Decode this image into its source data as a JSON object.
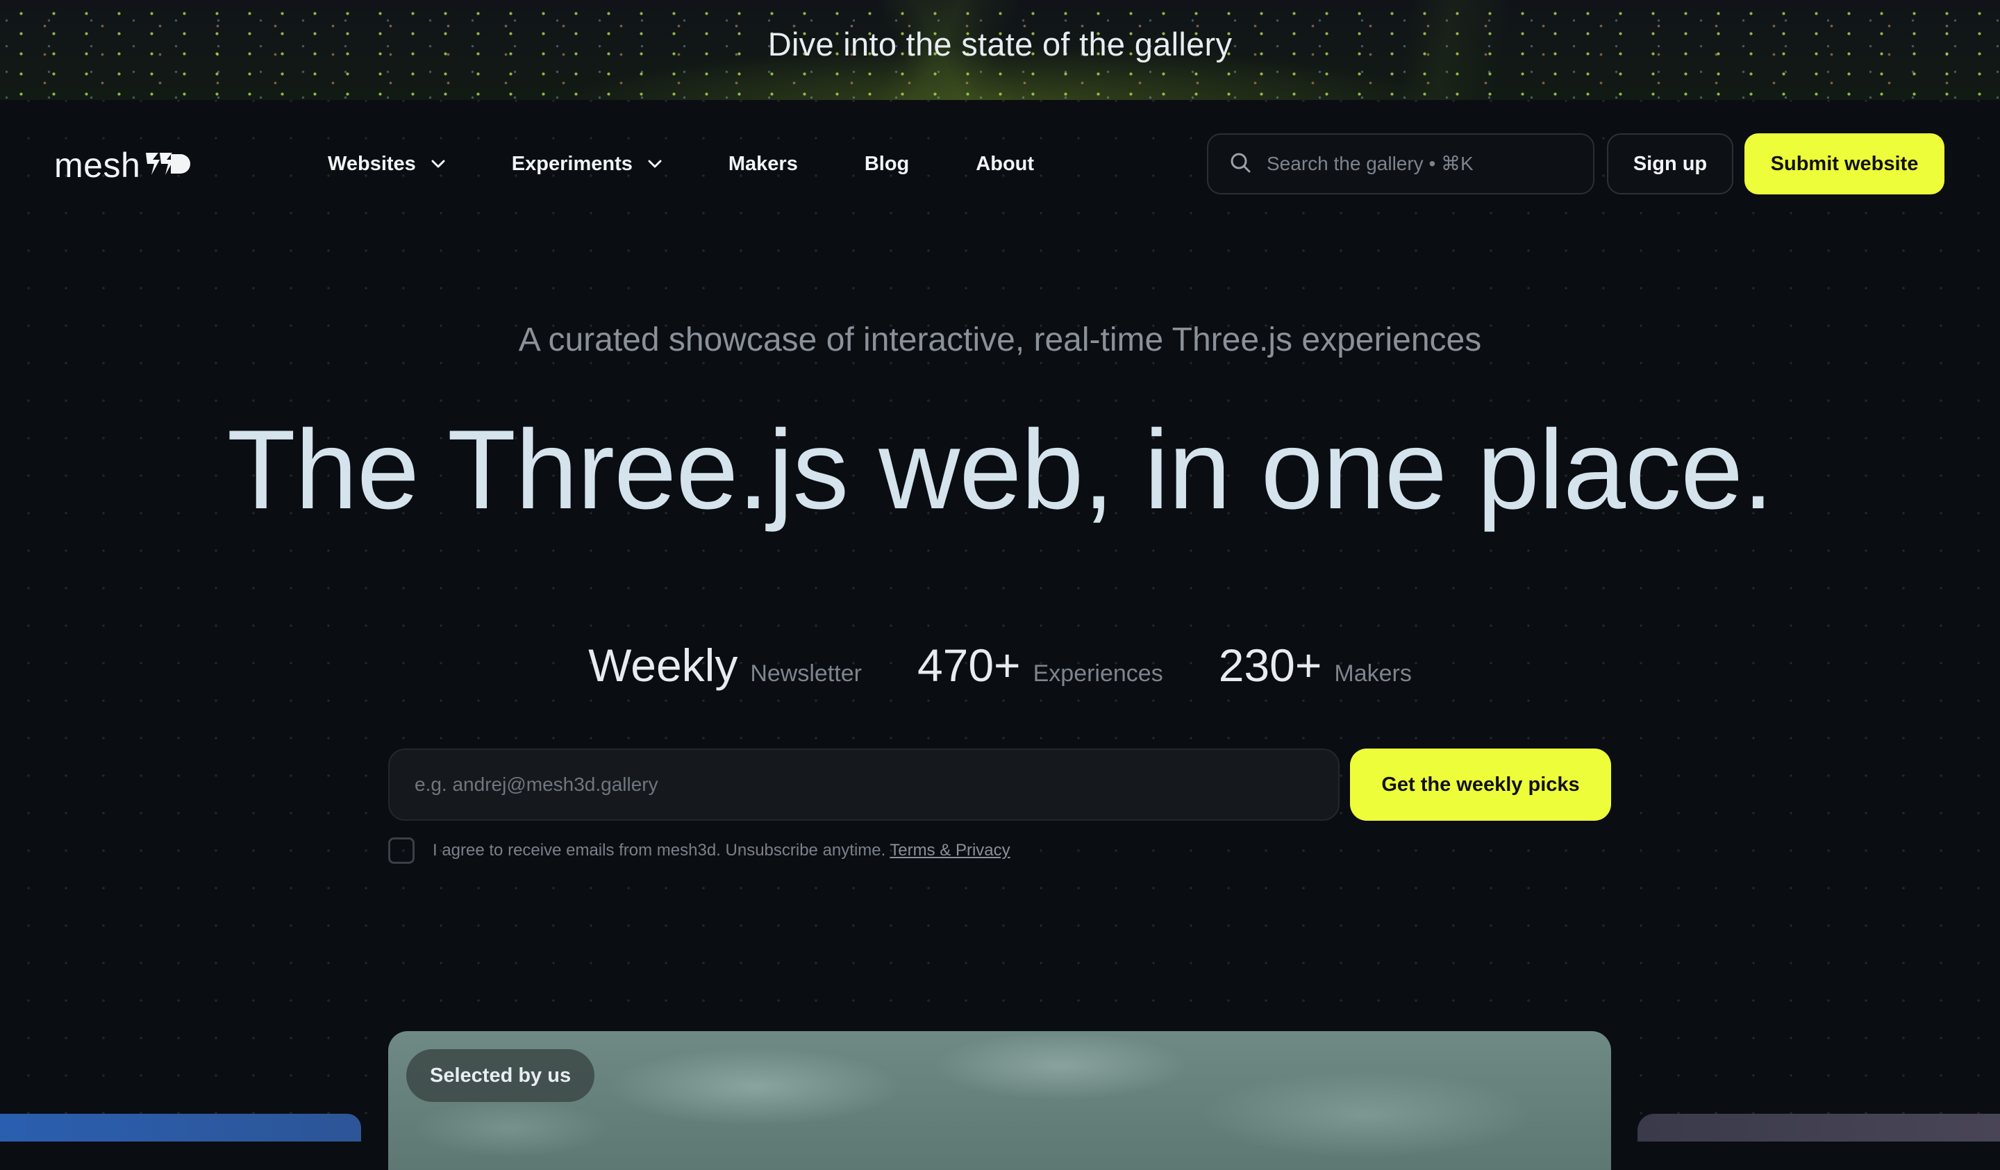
{
  "banner": {
    "text": "Dive into the state of the gallery"
  },
  "header": {
    "logo_text": "mesh",
    "logo_icon": "mesh3d-logo-mark",
    "nav": [
      {
        "label": "Websites",
        "dropdown": true
      },
      {
        "label": "Experiments",
        "dropdown": true
      },
      {
        "label": "Makers",
        "dropdown": false
      },
      {
        "label": "Blog",
        "dropdown": false
      },
      {
        "label": "About",
        "dropdown": false
      }
    ],
    "search": {
      "placeholder": "Search the gallery • ⌘K",
      "icon": "search-icon"
    },
    "signup_label": "Sign up",
    "submit_label": "Submit website"
  },
  "hero": {
    "tagline": "A curated showcase of interactive, real-time Three.js experiences",
    "headline": "The Three.js web, in one place.",
    "stats": [
      {
        "value": "Weekly",
        "label": "Newsletter"
      },
      {
        "value": "470+",
        "label": "Experiences"
      },
      {
        "value": "230+",
        "label": "Makers"
      }
    ]
  },
  "newsletter": {
    "email_placeholder": "e.g. andrej@mesh3d.gallery",
    "button_label": "Get the weekly picks",
    "consent_text": "I agree to receive emails from mesh3d. Unsubscribe anytime.",
    "consent_link": "Terms & Privacy",
    "consent_checked": false
  },
  "featured": {
    "badge": "Selected by us"
  },
  "colors": {
    "background": "#0a0d12",
    "accent": "#eefd3a",
    "headline": "#d4e3ec",
    "muted": "#8a9199"
  }
}
